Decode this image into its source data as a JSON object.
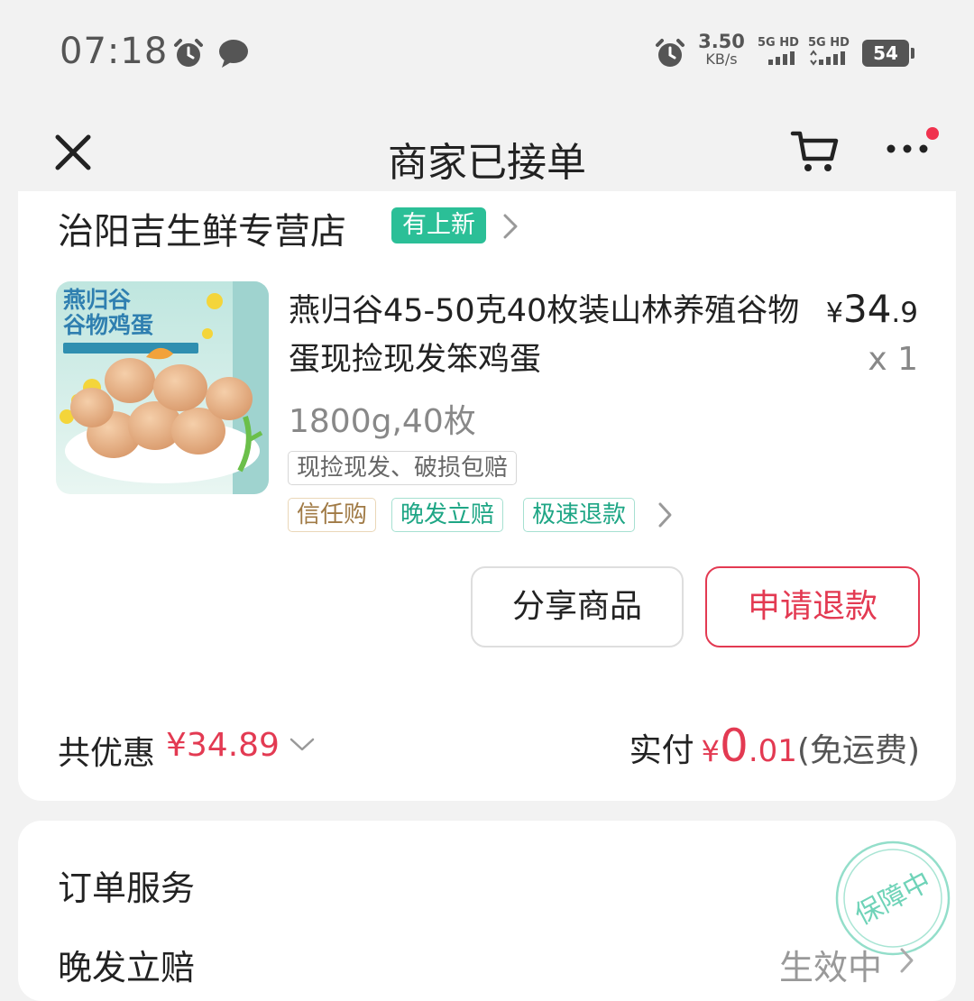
{
  "status_bar": {
    "time": "07:18",
    "net_speed_value": "3.50",
    "net_speed_unit": "KB/s",
    "sim1_label": "5G HD",
    "sim2_label": "5G HD",
    "battery": "54",
    "icons": [
      "alarm-icon",
      "chat-icon",
      "alarm-icon",
      "signal-icon",
      "battery-icon"
    ]
  },
  "nav": {
    "title": "商家已接单",
    "icons": [
      "close-icon",
      "cart-icon",
      "more-icon"
    ],
    "notification_dot_color": "#f0324e"
  },
  "shop": {
    "name": "治阳吉生鲜专营店",
    "badge": "有上新",
    "badge_color": "#2bbf97"
  },
  "product": {
    "image_text_line1": "燕归谷",
    "image_text_line2": "谷物鸡蛋",
    "title": "燕归谷45-50克40枚装山林养殖谷物蛋现捡现发笨鸡蛋",
    "price_symbol": "¥",
    "price_int": "34",
    "price_dec": ".9",
    "quantity": "x 1",
    "spec": "1800g,40枚",
    "promise_tag": "现捡现发、破损包赔",
    "service_tags": [
      "信任购",
      "晚发立赔",
      "极速退款"
    ]
  },
  "actions": {
    "share": "分享商品",
    "refund": "申请退款",
    "refund_color": "#e33a52"
  },
  "summary": {
    "discount_label": "共优惠",
    "discount_value": "¥34.89",
    "paid_label": "实付",
    "paid_symbol": "¥",
    "paid_int": "0",
    "paid_dec": ".01",
    "paid_note": "(免运费)"
  },
  "service": {
    "title": "订单服务",
    "late_label": "晚发立赔",
    "late_status": "生效中",
    "stamp_text": "保障中",
    "stamp_color": "#6fd3b8"
  }
}
